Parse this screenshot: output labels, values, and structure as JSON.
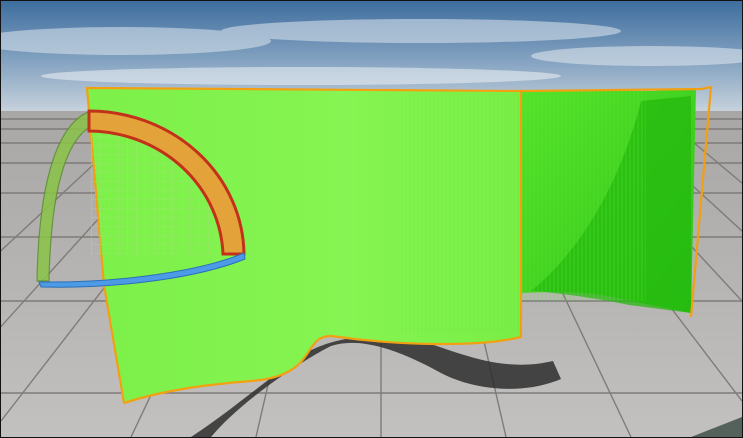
{
  "viewport": {
    "kind": "3d-editor-viewport",
    "selected_object_outline_color": "#F2A012",
    "mesh_color": "#7CF24A",
    "mesh_shadow_color": "#38D01A",
    "gizmo": {
      "rotate_ring_red": "#D23A1A",
      "rotate_ring_green": "#7DB43A",
      "rotate_ring_blue": "#3A8CE0"
    },
    "floor_color": "#B9B6B3",
    "sky_color": "#5F86AE"
  }
}
